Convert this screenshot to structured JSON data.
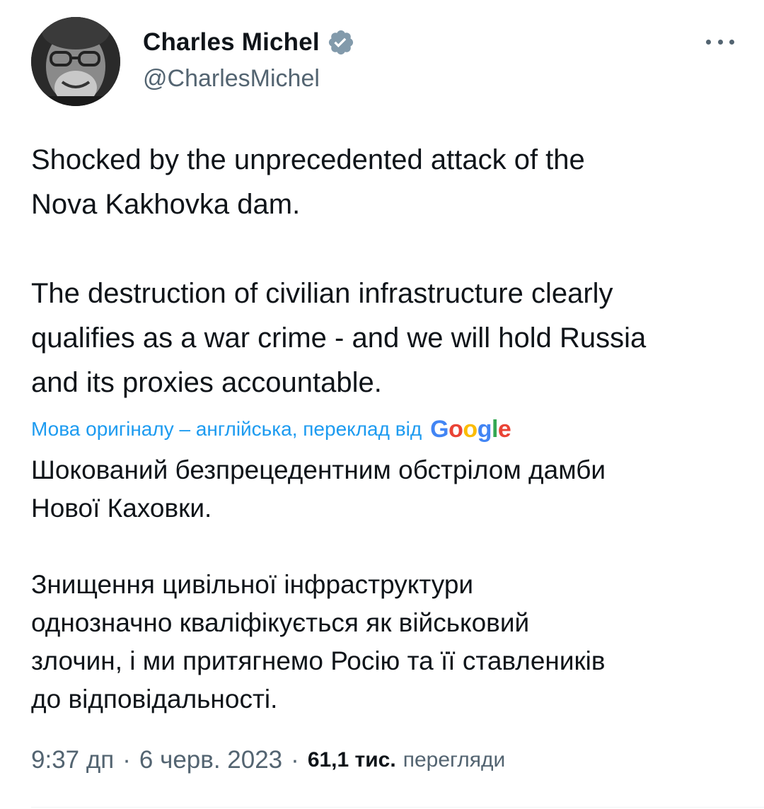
{
  "author": {
    "name": "Charles Michel",
    "handle": "@CharlesMichel",
    "verified_color": "#829aab"
  },
  "tweet": {
    "text": "Shocked by the unprecedented attack of the\nNova Kakhovka dam.\n\nThe destruction of civilian infrastructure clearly\nqualifies as a war crime - and we will hold Russia\nand its proxies accountable."
  },
  "translation": {
    "label": "Мова оригіналу – англійська, переклад від",
    "provider_letters": [
      "G",
      "o",
      "o",
      "g",
      "l",
      "e"
    ],
    "text": "Шокований безпрецедентним обстрілом дамби\nНової Каховки.\n\nЗнищення цивільної інфраструктури\nоднозначно кваліфікується як військовий\nзлочин, і ми притягнемо Росію та її ставлеників\nдо відповідальності."
  },
  "meta": {
    "time": "9:37 дп",
    "separator": "·",
    "date": "6 черв. 2023",
    "views_count": "61,1 тис.",
    "views_label": "перегляди"
  },
  "colors": {
    "link": "#1d9bf0",
    "secondary_text": "#536471",
    "primary_text": "#0f1419"
  },
  "icons": {
    "more": "more-horizontal-icon",
    "verified": "verified-badge-icon"
  }
}
